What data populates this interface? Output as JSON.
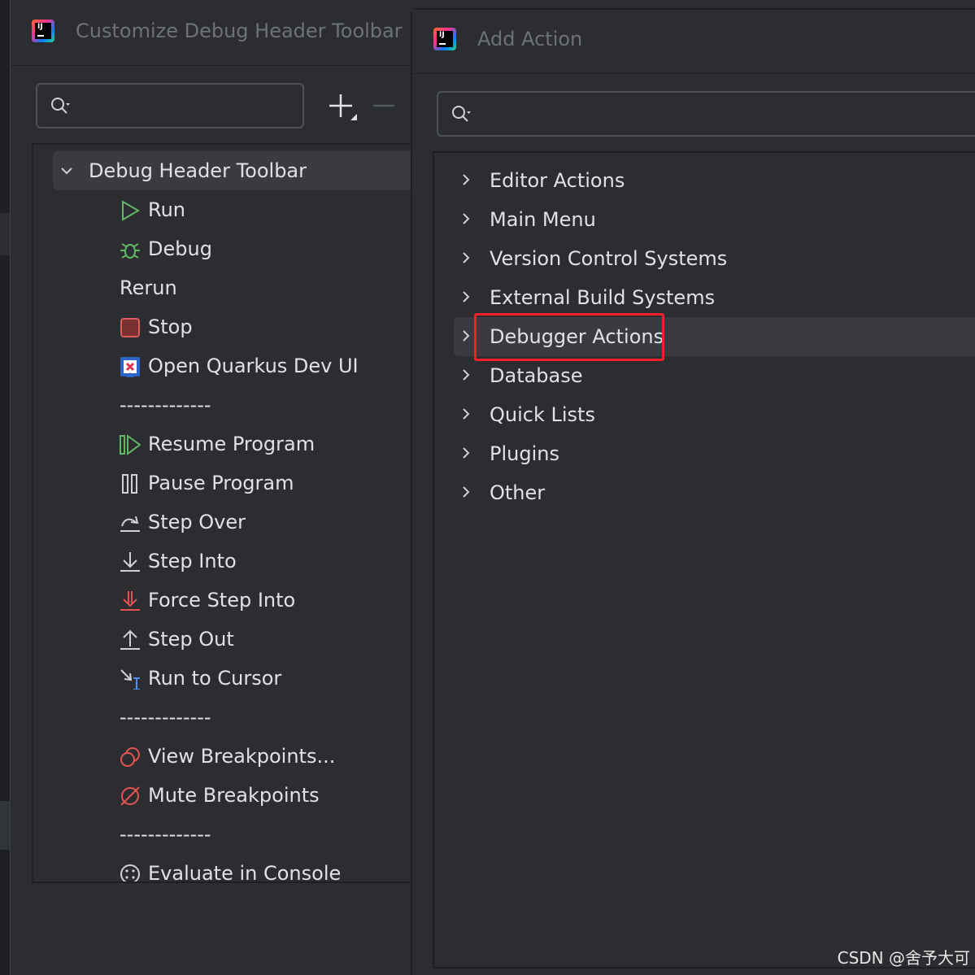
{
  "left_dialog": {
    "title": "Customize Debug Header Toolbar",
    "search_value": "",
    "add_label": "+",
    "remove_label": "—",
    "tree": {
      "root_label": "Debug Header Toolbar",
      "items": [
        {
          "label": "Run",
          "icon": "run-icon"
        },
        {
          "label": "Debug",
          "icon": "debug-icon"
        },
        {
          "label": "Rerun",
          "icon": ""
        },
        {
          "label": "Stop",
          "icon": "stop-icon"
        },
        {
          "label": "Open Quarkus Dev UI",
          "icon": "quarkus-icon"
        },
        {
          "label": "-------------",
          "icon": ""
        },
        {
          "label": "Resume Program",
          "icon": "resume-icon"
        },
        {
          "label": "Pause Program",
          "icon": "pause-icon"
        },
        {
          "label": "Step Over",
          "icon": "step-over-icon"
        },
        {
          "label": "Step Into",
          "icon": "step-into-icon"
        },
        {
          "label": "Force Step Into",
          "icon": "force-step-into-icon"
        },
        {
          "label": "Step Out",
          "icon": "step-out-icon"
        },
        {
          "label": "Run to Cursor",
          "icon": "run-to-cursor-icon"
        },
        {
          "label": "-------------",
          "icon": ""
        },
        {
          "label": "View Breakpoints...",
          "icon": "view-breakpoints-icon"
        },
        {
          "label": "Mute Breakpoints",
          "icon": "mute-breakpoints-icon"
        },
        {
          "label": "-------------",
          "icon": ""
        },
        {
          "label": "Evaluate in Console",
          "icon": "evaluate-icon"
        }
      ]
    }
  },
  "right_dialog": {
    "title": "Add Action",
    "search_value": "",
    "groups": [
      "Editor Actions",
      "Main Menu",
      "Version Control Systems",
      "External Build Systems",
      "Debugger Actions",
      "Database",
      "Quick Lists",
      "Plugins",
      "Other"
    ],
    "selected_group": "Debugger Actions"
  },
  "colors": {
    "highlight": "#f3202a",
    "run_green": "#5fb865",
    "stop_red": "#db5c5c",
    "breakpoint_red": "#e55353"
  },
  "watermark": "CSDN @舍予大可"
}
